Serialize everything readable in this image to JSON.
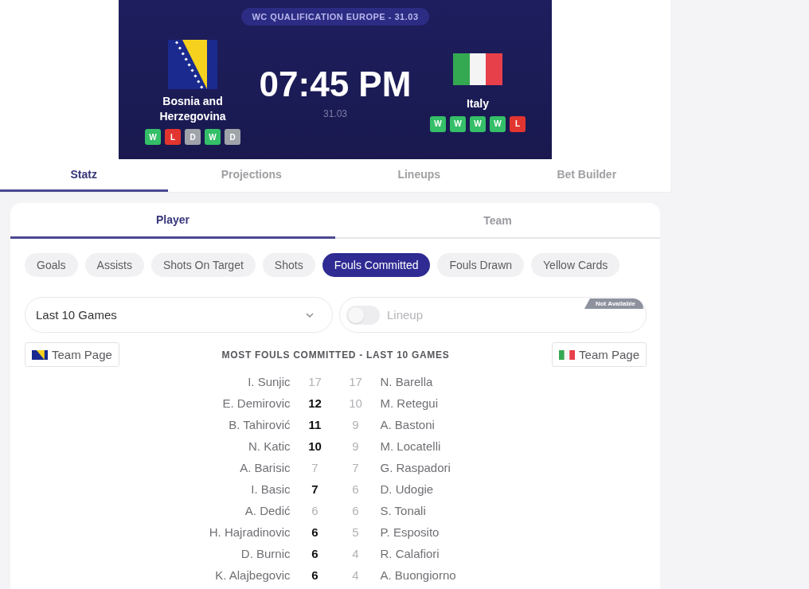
{
  "match": {
    "competition": "WC QUALIFICATION EUROPE - 31.03",
    "time": "07:45 PM",
    "date": "31.03",
    "home": {
      "name": "Bosnia and Herzegovina",
      "form": [
        {
          "result": "W",
          "color": "#34bf68"
        },
        {
          "result": "L",
          "color": "#e2352f"
        },
        {
          "result": "D",
          "color": "#a0a4aa"
        },
        {
          "result": "W",
          "color": "#34bf68"
        },
        {
          "result": "D",
          "color": "#a0a4aa"
        }
      ]
    },
    "away": {
      "name": "Italy",
      "form": [
        {
          "result": "W",
          "color": "#34bf68"
        },
        {
          "result": "W",
          "color": "#34bf68"
        },
        {
          "result": "W",
          "color": "#34bf68"
        },
        {
          "result": "W",
          "color": "#34bf68"
        },
        {
          "result": "L",
          "color": "#e2352f"
        }
      ]
    }
  },
  "tabs": [
    {
      "label": "Statz",
      "selected": true
    },
    {
      "label": "Projections",
      "selected": false
    },
    {
      "label": "Lineups",
      "selected": false
    },
    {
      "label": "Bet Builder",
      "selected": false
    }
  ],
  "subtabs": [
    {
      "label": "Player",
      "selected": true
    },
    {
      "label": "Team",
      "selected": false
    }
  ],
  "stat_chips": [
    {
      "label": "Goals",
      "selected": false
    },
    {
      "label": "Assists",
      "selected": false
    },
    {
      "label": "Shots On Target",
      "selected": false
    },
    {
      "label": "Shots",
      "selected": false
    },
    {
      "label": "Fouls Committed",
      "selected": true
    },
    {
      "label": "Fouls Drawn",
      "selected": false
    },
    {
      "label": "Yellow Cards",
      "selected": false
    }
  ],
  "period_select": {
    "value": "Last 10 Games"
  },
  "lineup": {
    "label": "Lineup",
    "on": false,
    "disabled": true,
    "badge": "Not Available"
  },
  "home_team_button": "Team Page",
  "away_team_button": "Team Page",
  "leaderboard": {
    "title": "MOST FOULS COMMITTED - LAST 10 GAMES",
    "rows": [
      {
        "home": {
          "player": "I. Sunjic",
          "value": "17",
          "highlighted": false
        },
        "away": {
          "player": "N. Barella",
          "value": "17",
          "highlighted": false
        }
      },
      {
        "home": {
          "player": "E. Demirovic",
          "value": "12",
          "highlighted": true
        },
        "away": {
          "player": "M. Retegui",
          "value": "10",
          "highlighted": false
        }
      },
      {
        "home": {
          "player": "B. Tahirović",
          "value": "11",
          "highlighted": true
        },
        "away": {
          "player": "A. Bastoni",
          "value": "9",
          "highlighted": false
        }
      },
      {
        "home": {
          "player": "N. Katic",
          "value": "10",
          "highlighted": true
        },
        "away": {
          "player": "M. Locatelli",
          "value": "9",
          "highlighted": false
        }
      },
      {
        "home": {
          "player": "A. Barisic",
          "value": "7",
          "highlighted": false
        },
        "away": {
          "player": "G. Raspadori",
          "value": "7",
          "highlighted": false
        }
      },
      {
        "home": {
          "player": "I. Basic",
          "value": "7",
          "highlighted": true
        },
        "away": {
          "player": "D. Udogie",
          "value": "6",
          "highlighted": false
        }
      },
      {
        "home": {
          "player": "A. Dedić",
          "value": "6",
          "highlighted": false
        },
        "away": {
          "player": "S. Tonali",
          "value": "6",
          "highlighted": false
        }
      },
      {
        "home": {
          "player": "H. Hajradinovic",
          "value": "6",
          "highlighted": true
        },
        "away": {
          "player": "P. Esposito",
          "value": "5",
          "highlighted": false
        }
      },
      {
        "home": {
          "player": "D. Burnic",
          "value": "6",
          "highlighted": true
        },
        "away": {
          "player": "R. Calafiori",
          "value": "4",
          "highlighted": false
        }
      },
      {
        "home": {
          "player": "K. Alajbegovic",
          "value": "6",
          "highlighted": true
        },
        "away": {
          "player": "A. Buongiorno",
          "value": "4",
          "highlighted": false
        }
      }
    ]
  }
}
